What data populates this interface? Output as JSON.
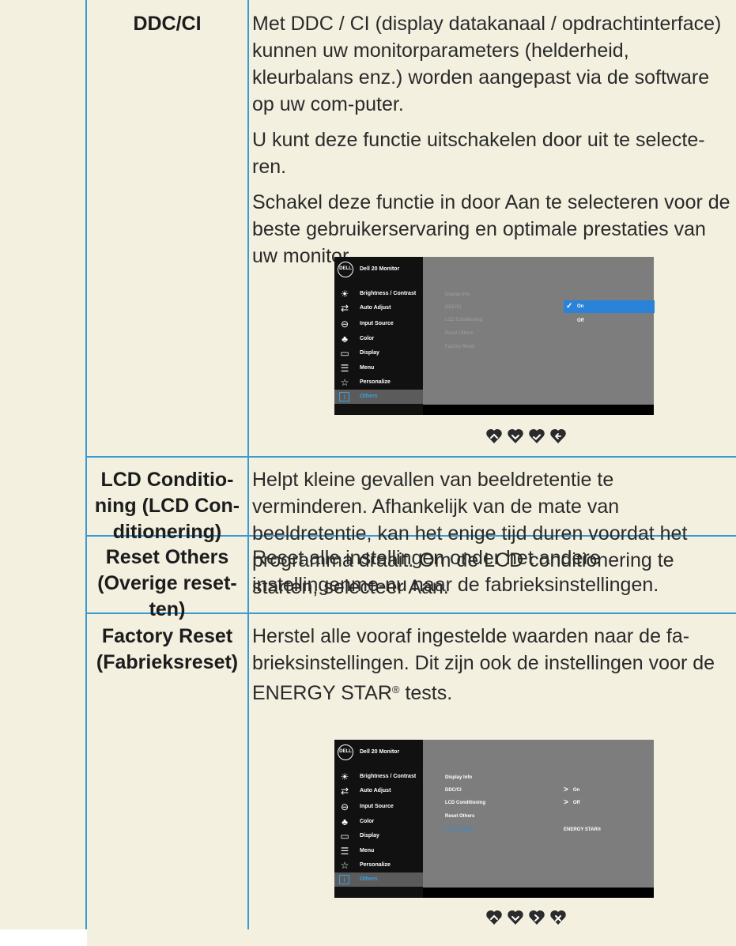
{
  "rows": [
    {
      "label": "DDC/CI",
      "paragraphs": [
        "Met DDC / CI (display datakanaal / opdrachtinterface) kunnen uw monitorparameters (helderheid, kleurbalans enz.) worden aangepast via de software op uw com-puter.",
        "U kunt deze functie uitschakelen door uit te selecte-ren.",
        "Schakel deze functie in door Aan te selecteren voor de beste gebruikerservaring en optimale prestaties van uw monitor."
      ]
    },
    {
      "label": "LCD Conditio-ning (LCD Con-ditionering)",
      "paragraphs": [
        "Helpt kleine gevallen van beeldretentie te verminderen. Afhankelijk van de mate van beeldretentie, kan het enige tijd duren voordat het programma draait. Om de LCD conditionering te starten, selecteer Aan."
      ]
    },
    {
      "label": "Reset Others (Overige reset-ten)",
      "paragraphs": [
        "Reset alle instellingen onder het andere instellingenme-nu naar de fabrieksinstellingen."
      ]
    },
    {
      "label": "Factory Reset (Fabrieksreset)",
      "paragraphs_main": "Herstel alle vooraf ingestelde waarden naar de fa-brieksinstellingen. Dit zijn ook de instellingen voor de ENERGY STAR",
      "reg_mark": "®",
      "paragraphs_tail": " tests."
    }
  ],
  "osd": {
    "logo": "DELL",
    "model": "Dell 20 Monitor",
    "menu": [
      {
        "label": "Brightness / Contrast",
        "icon": "brightness-icon",
        "glyph": "☀"
      },
      {
        "label": "Auto Adjust",
        "icon": "auto-adjust-icon",
        "glyph": "⇄"
      },
      {
        "label": "Input Source",
        "icon": "input-source-icon",
        "glyph": "⊖"
      },
      {
        "label": "Color",
        "icon": "color-icon",
        "glyph": "♣"
      },
      {
        "label": "Display",
        "icon": "display-icon",
        "glyph": "▭"
      },
      {
        "label": "Menu",
        "icon": "menu-icon",
        "glyph": "☰"
      },
      {
        "label": "Personalize",
        "icon": "star-icon",
        "glyph": "☆"
      },
      {
        "label": "Others",
        "icon": "others-icon",
        "glyph": "i"
      }
    ],
    "submenu": [
      "Display Info",
      "DDC/CI",
      "LCD Conditioning",
      "Reset Others",
      "Factory Reset"
    ],
    "ddc_options": [
      "On",
      "Off"
    ],
    "factory_values": {
      "ddc": "On",
      "lcd": "Off",
      "energy": "ENERGY STAR®"
    },
    "selected_color": "#2a83d8",
    "nav_buttons_1": [
      "up-icon",
      "down-icon",
      "confirm-icon",
      "back-icon"
    ],
    "nav_buttons_2": [
      "up-icon",
      "down-icon",
      "next-icon",
      "exit-icon"
    ]
  }
}
